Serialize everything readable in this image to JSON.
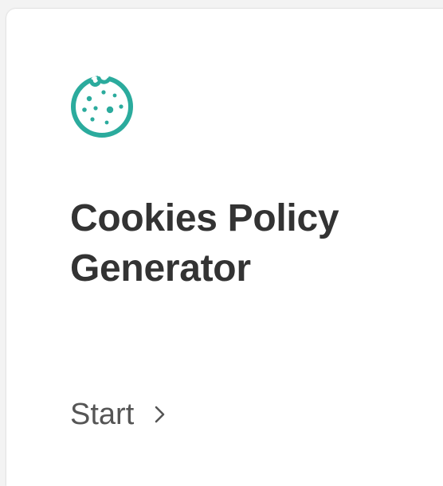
{
  "card": {
    "icon": "cookie-icon",
    "title_line1": "Cookies Policy",
    "title_line2": "Generator",
    "action_label": "Start",
    "action_icon": "chevron-right-icon"
  },
  "colors": {
    "accent": "#2bab9d",
    "title": "#333333",
    "action": "#555555",
    "card_bg": "#ffffff",
    "page_bg": "#f3f3f3"
  }
}
